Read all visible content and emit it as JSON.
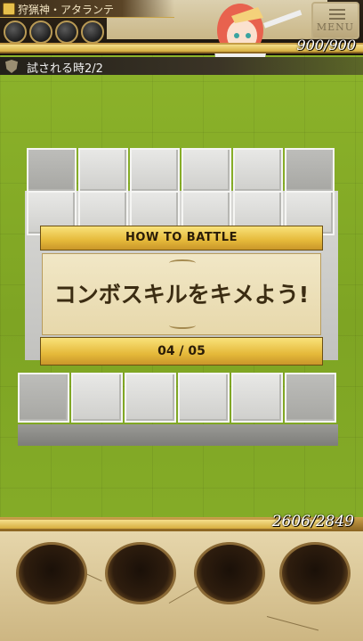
{
  "header": {
    "boss_name": "狩猟神・アタランテ",
    "menu_label": "MENU",
    "enemy_hp_text": "900/900",
    "enemy_hp_fraction": 1.0,
    "orb_slots": 4
  },
  "trial": {
    "label": "試される時2/2"
  },
  "dialog": {
    "header": "HOW TO BATTLE",
    "message": "コンボスキルをキメよう!",
    "page": "04 / 05"
  },
  "player": {
    "hp_text": "2606/2849",
    "hp_fraction": 0.915
  },
  "skill_slots": 4,
  "colors": {
    "grass": "#8fb62c",
    "gold": "#e5b93a",
    "parchment": "#f1e7c6",
    "tile": "#e8e8e6"
  },
  "icons": [
    "crown-icon",
    "shield-icon",
    "menu-icon"
  ]
}
